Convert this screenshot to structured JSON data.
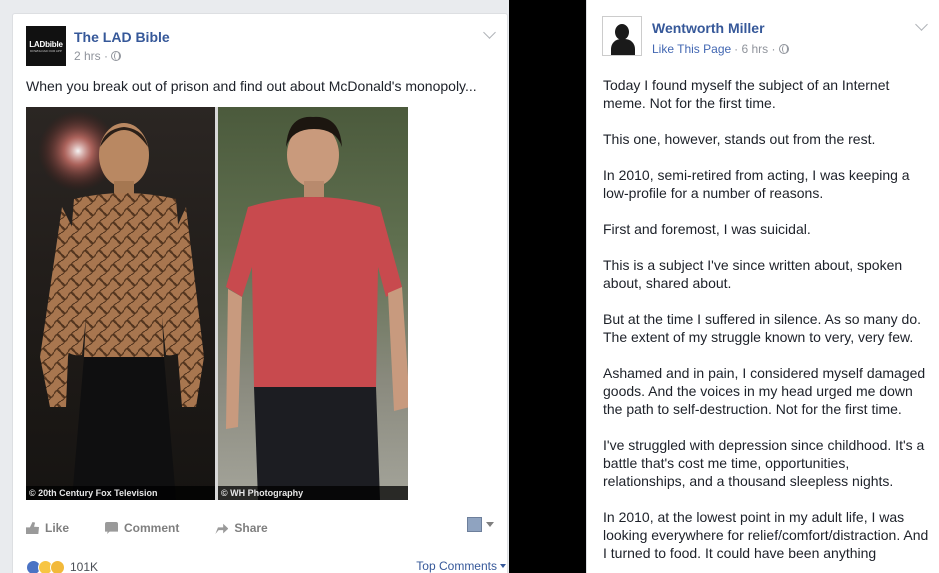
{
  "left_post": {
    "avatar": {
      "brand": "LADbible",
      "tagline": "DOWNLOAD OUR APP"
    },
    "author": "The LAD Bible",
    "time": "2 hrs ·",
    "text": "When you break out of prison and find out about McDonald's monopoly...",
    "photo": {
      "caption_left": "© 20th Century Fox Television",
      "caption_right": "© WH Photography"
    },
    "actions": {
      "like": "Like",
      "comment": "Comment",
      "share": "Share"
    },
    "reactions": {
      "count": "101K",
      "top_comments": "Top Comments"
    }
  },
  "right_post": {
    "author": "Wentworth Miller",
    "like_page": "Like This Page",
    "time": "· 6 hrs ·",
    "paragraphs": [
      "Today I found myself the subject of an Internet meme. Not for the first time.",
      "This one, however, stands out from the rest.",
      "In 2010, semi-retired from acting, I was keeping a low-profile for a number of reasons.",
      "First and foremost, I was suicidal.",
      "This is a subject I've since written about, spoken about, shared about.",
      "But at the time I suffered in silence. As so many do. The extent of my struggle known to very, very few.",
      "Ashamed and in pain, I considered myself damaged goods. And the voices in my head urged me down the path to self-destruction. Not for the first time.",
      "I've struggled with depression since childhood. It's a battle that's cost me time, opportunities, relationships, and a thousand sleepless nights.",
      "In 2010, at the lowest point in my adult life, I was looking everywhere for relief/comfort/distraction. And I turned to food. It could have been anything"
    ]
  },
  "colors": {
    "link": "#365899",
    "muted": "#90949c",
    "action": "#7f7f7f",
    "backdrop": "#000000"
  }
}
